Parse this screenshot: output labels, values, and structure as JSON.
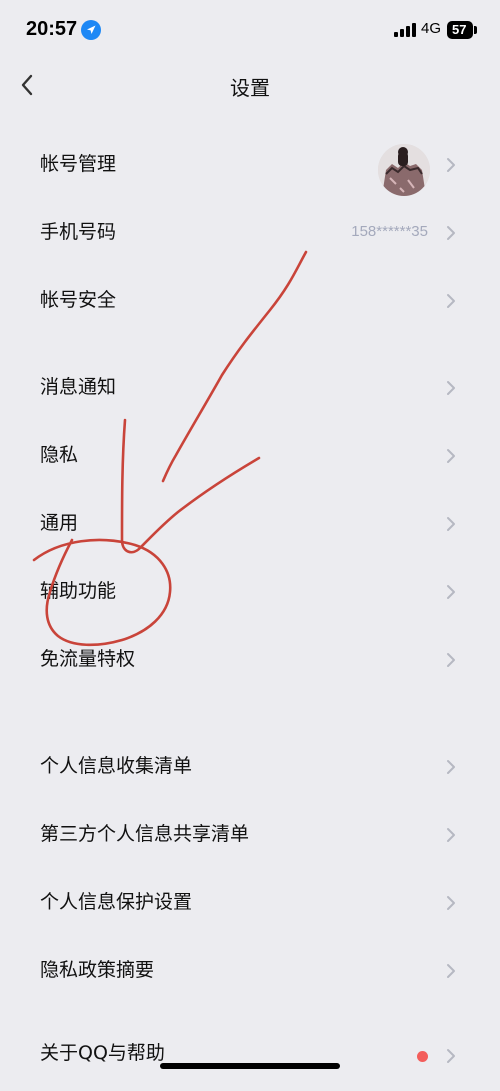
{
  "status_bar": {
    "time": "20:57",
    "network": "4G",
    "battery": "57"
  },
  "nav": {
    "title": "设置"
  },
  "groups": [
    {
      "items": [
        {
          "label": "帐号管理",
          "accessory": "avatar"
        },
        {
          "label": "手机号码",
          "value": "158******35"
        },
        {
          "label": "帐号安全"
        }
      ]
    },
    {
      "items": [
        {
          "label": "消息通知"
        },
        {
          "label": "隐私"
        },
        {
          "label": "通用"
        },
        {
          "label": "辅助功能"
        },
        {
          "label": "免流量特权"
        }
      ]
    },
    {
      "items": [
        {
          "label": "个人信息收集清单"
        },
        {
          "label": "第三方个人信息共享清单"
        },
        {
          "label": "个人信息保护设置"
        },
        {
          "label": "隐私政策摘要"
        }
      ]
    },
    {
      "items": [
        {
          "label": "关于QQ与帮助",
          "accessory": "red-dot"
        }
      ]
    }
  ],
  "colors": {
    "background": "#ececf0",
    "value_text": "#a4a9bc",
    "chevron": "#b6b8c2",
    "badge": "#f35d5b",
    "annotation": "#c0392b"
  },
  "icons": [
    "location-arrow-icon",
    "signal-icon",
    "back-icon",
    "chevron-right-icon"
  ]
}
